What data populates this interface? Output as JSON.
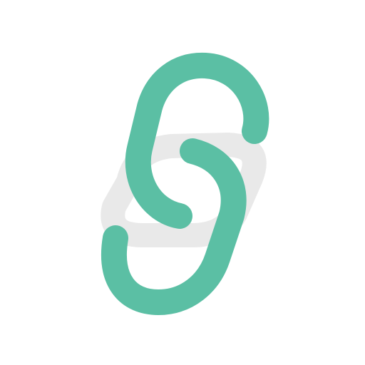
{
  "icon": {
    "name": "link-icon",
    "colors": {
      "background": "#ffffff",
      "chain": "#5bbfa4",
      "shadow": "#e9e9e9"
    }
  }
}
